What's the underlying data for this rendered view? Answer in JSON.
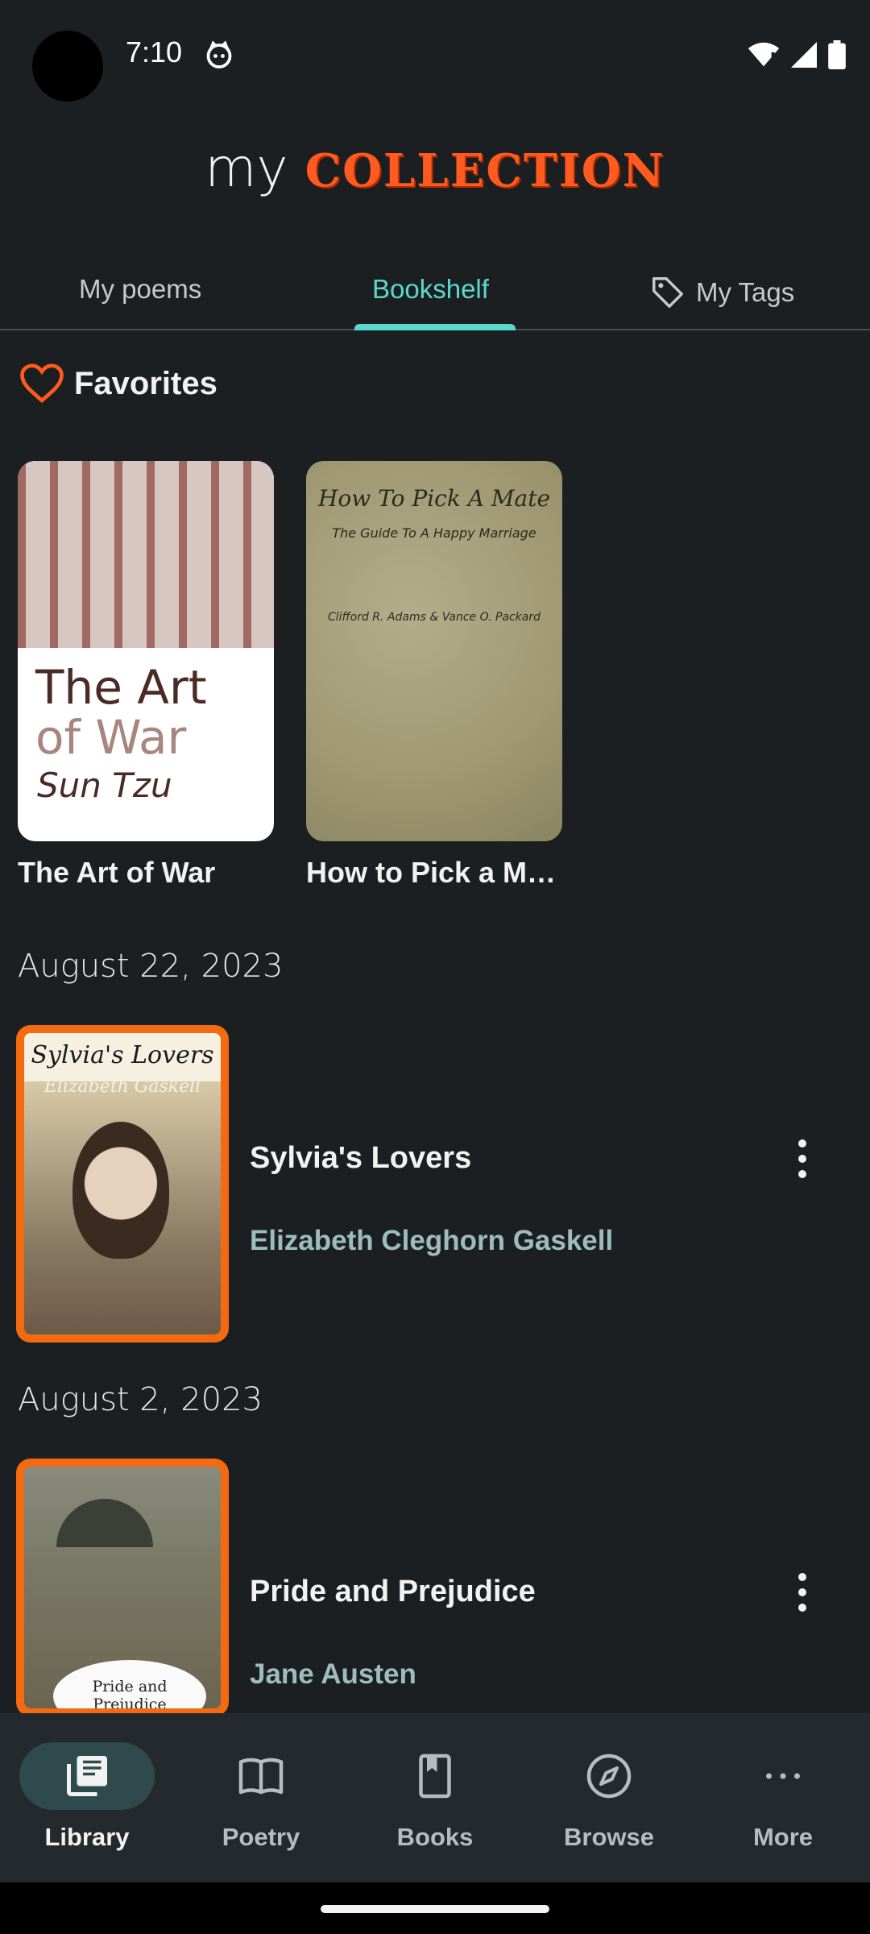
{
  "status_bar": {
    "time": "7:10"
  },
  "header": {
    "title_prefix": "my",
    "title_brand": "COLLECTION"
  },
  "tabs": [
    {
      "label": "My poems",
      "active": false
    },
    {
      "label": "Bookshelf",
      "active": true
    },
    {
      "label": "My Tags",
      "active": false,
      "icon": "tag-icon"
    }
  ],
  "favorites": {
    "title": "Favorites",
    "items": [
      {
        "title": "The Art of War",
        "cover": {
          "line1": "The Art",
          "line2": "of War",
          "line3": "Sun Tzu"
        }
      },
      {
        "title": "How to Pick a M…",
        "cover": {
          "line1": "How To Pick A Mate",
          "line2": "The Guide To A Happy Marriage",
          "line3": "Clifford R. Adams & Vance O. Packard"
        }
      }
    ]
  },
  "sections": [
    {
      "date": "August 22, 2023",
      "book": {
        "title": "Sylvia's Lovers",
        "author": "Elizabeth Cleghorn Gaskell",
        "cover": {
          "line1": "Sylvia's Lovers",
          "line2": "Elizabeth Gaskell"
        }
      }
    },
    {
      "date": "August 2, 2023",
      "book": {
        "title": "Pride and Prejudice",
        "author": "Jane Austen",
        "cover": {
          "line1": "Pride and Prejudice"
        }
      }
    }
  ],
  "bottom_nav": [
    {
      "label": "Library",
      "icon": "library-icon",
      "active": true
    },
    {
      "label": "Poetry",
      "icon": "open-book-icon",
      "active": false
    },
    {
      "label": "Books",
      "icon": "bookmark-book-icon",
      "active": false
    },
    {
      "label": "Browse",
      "icon": "compass-icon",
      "active": false
    },
    {
      "label": "More",
      "icon": "more-horizontal-icon",
      "active": false
    }
  ],
  "colors": {
    "background": "#1b1f21",
    "accent": "#5ad8d0",
    "brand": "#ff5a1f",
    "author": "#9dbdb8",
    "cover_border": "#f36a10"
  }
}
